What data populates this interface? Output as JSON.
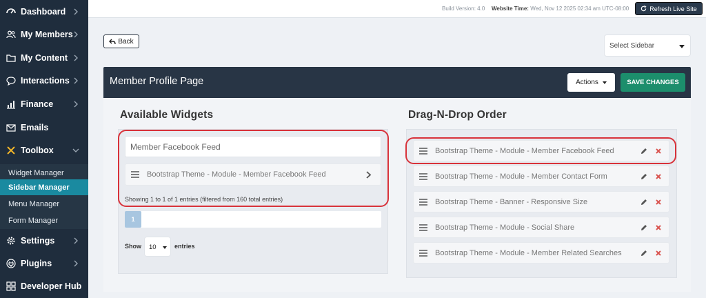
{
  "sidebar": {
    "items": [
      {
        "label": "Dashboard",
        "icon": "dashboard-icon"
      },
      {
        "label": "My Members",
        "icon": "members-icon"
      },
      {
        "label": "My Content",
        "icon": "folder-icon"
      },
      {
        "label": "Interactions",
        "icon": "chat-icon"
      },
      {
        "label": "Finance",
        "icon": "chart-icon"
      },
      {
        "label": "Emails",
        "icon": "envelope-icon"
      },
      {
        "label": "Toolbox",
        "icon": "tools-icon"
      },
      {
        "label": "Settings",
        "icon": "gear-icon"
      },
      {
        "label": "Plugins",
        "icon": "plugin-icon"
      },
      {
        "label": "Developer Hub",
        "icon": "grid-icon"
      }
    ],
    "toolbox_items": [
      {
        "label": "Widget Manager"
      },
      {
        "label": "Sidebar Manager",
        "active": true
      },
      {
        "label": "Menu Manager"
      },
      {
        "label": "Form Manager"
      }
    ]
  },
  "topbar": {
    "build_version": "Build Version: 4.0",
    "website_time_label": "Website Time:",
    "website_time_value": "Wed, Nov 12 2025 02:34 am UTC-08:00",
    "refresh_label": "Refresh Live Site"
  },
  "back_label": "Back",
  "select_sidebar": {
    "value": "Select Sidebar"
  },
  "panel": {
    "title": "Member Profile Page",
    "actions_label": "Actions",
    "save_label": "SAVE CHANGES"
  },
  "available": {
    "title": "Available Widgets",
    "search_value": "Member Facebook Feed",
    "results": [
      "Bootstrap Theme - Module - Member Facebook Feed"
    ],
    "showing_text": "Showing 1 to 1 of 1 entries (filtered from 160 total entries)",
    "page": "1",
    "show_label": "Show",
    "length_value": "10",
    "entries_label": "entries"
  },
  "order": {
    "title": "Drag-N-Drop Order",
    "items": [
      "Bootstrap Theme - Module - Member Facebook Feed",
      "Bootstrap Theme - Module - Member Contact Form",
      "Bootstrap Theme - Banner - Responsive Size",
      "Bootstrap Theme - Module - Social Share",
      "Bootstrap Theme - Module - Member Related Searches"
    ]
  },
  "colors": {
    "sidebar_bg": "#1f2d3d",
    "active_sub": "#1a8aa0",
    "save_green": "#1c8e6c",
    "highlight_red": "#d8323a",
    "delete_red": "#d9534f"
  }
}
